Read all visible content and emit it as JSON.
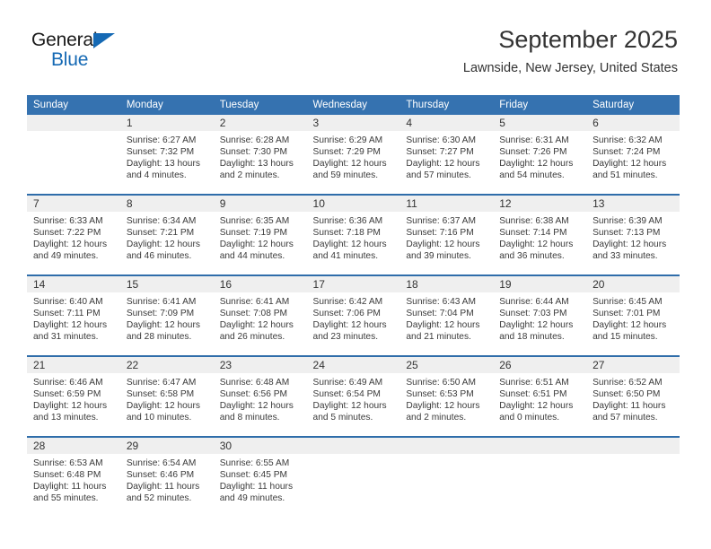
{
  "logo": {
    "word_top": "General",
    "word_bottom": "Blue",
    "triangle_icon": "blue-triangle-icon",
    "blue": "#1569b4"
  },
  "header": {
    "title": "September 2025",
    "subtitle": "Lawnside, New Jersey, United States"
  },
  "colors": {
    "header_row": "#3572b0",
    "row_divider": "#2f6daa",
    "day_band": "#efefef",
    "text": "#333333"
  },
  "weekday_headers": [
    "Sunday",
    "Monday",
    "Tuesday",
    "Wednesday",
    "Thursday",
    "Friday",
    "Saturday"
  ],
  "labels": {
    "sunrise_prefix": "Sunrise:",
    "sunset_prefix": "Sunset:",
    "daylight_prefix": "Daylight:"
  },
  "weeks": [
    [
      {
        "day": "",
        "empty": true
      },
      {
        "day": "1",
        "sunrise": "Sunrise: 6:27 AM",
        "sunset": "Sunset: 7:32 PM",
        "daylight_1": "Daylight: 13 hours",
        "daylight_2": "and 4 minutes."
      },
      {
        "day": "2",
        "sunrise": "Sunrise: 6:28 AM",
        "sunset": "Sunset: 7:30 PM",
        "daylight_1": "Daylight: 13 hours",
        "daylight_2": "and 2 minutes."
      },
      {
        "day": "3",
        "sunrise": "Sunrise: 6:29 AM",
        "sunset": "Sunset: 7:29 PM",
        "daylight_1": "Daylight: 12 hours",
        "daylight_2": "and 59 minutes."
      },
      {
        "day": "4",
        "sunrise": "Sunrise: 6:30 AM",
        "sunset": "Sunset: 7:27 PM",
        "daylight_1": "Daylight: 12 hours",
        "daylight_2": "and 57 minutes."
      },
      {
        "day": "5",
        "sunrise": "Sunrise: 6:31 AM",
        "sunset": "Sunset: 7:26 PM",
        "daylight_1": "Daylight: 12 hours",
        "daylight_2": "and 54 minutes."
      },
      {
        "day": "6",
        "sunrise": "Sunrise: 6:32 AM",
        "sunset": "Sunset: 7:24 PM",
        "daylight_1": "Daylight: 12 hours",
        "daylight_2": "and 51 minutes."
      }
    ],
    [
      {
        "day": "7",
        "sunrise": "Sunrise: 6:33 AM",
        "sunset": "Sunset: 7:22 PM",
        "daylight_1": "Daylight: 12 hours",
        "daylight_2": "and 49 minutes."
      },
      {
        "day": "8",
        "sunrise": "Sunrise: 6:34 AM",
        "sunset": "Sunset: 7:21 PM",
        "daylight_1": "Daylight: 12 hours",
        "daylight_2": "and 46 minutes."
      },
      {
        "day": "9",
        "sunrise": "Sunrise: 6:35 AM",
        "sunset": "Sunset: 7:19 PM",
        "daylight_1": "Daylight: 12 hours",
        "daylight_2": "and 44 minutes."
      },
      {
        "day": "10",
        "sunrise": "Sunrise: 6:36 AM",
        "sunset": "Sunset: 7:18 PM",
        "daylight_1": "Daylight: 12 hours",
        "daylight_2": "and 41 minutes."
      },
      {
        "day": "11",
        "sunrise": "Sunrise: 6:37 AM",
        "sunset": "Sunset: 7:16 PM",
        "daylight_1": "Daylight: 12 hours",
        "daylight_2": "and 39 minutes."
      },
      {
        "day": "12",
        "sunrise": "Sunrise: 6:38 AM",
        "sunset": "Sunset: 7:14 PM",
        "daylight_1": "Daylight: 12 hours",
        "daylight_2": "and 36 minutes."
      },
      {
        "day": "13",
        "sunrise": "Sunrise: 6:39 AM",
        "sunset": "Sunset: 7:13 PM",
        "daylight_1": "Daylight: 12 hours",
        "daylight_2": "and 33 minutes."
      }
    ],
    [
      {
        "day": "14",
        "sunrise": "Sunrise: 6:40 AM",
        "sunset": "Sunset: 7:11 PM",
        "daylight_1": "Daylight: 12 hours",
        "daylight_2": "and 31 minutes."
      },
      {
        "day": "15",
        "sunrise": "Sunrise: 6:41 AM",
        "sunset": "Sunset: 7:09 PM",
        "daylight_1": "Daylight: 12 hours",
        "daylight_2": "and 28 minutes."
      },
      {
        "day": "16",
        "sunrise": "Sunrise: 6:41 AM",
        "sunset": "Sunset: 7:08 PM",
        "daylight_1": "Daylight: 12 hours",
        "daylight_2": "and 26 minutes."
      },
      {
        "day": "17",
        "sunrise": "Sunrise: 6:42 AM",
        "sunset": "Sunset: 7:06 PM",
        "daylight_1": "Daylight: 12 hours",
        "daylight_2": "and 23 minutes."
      },
      {
        "day": "18",
        "sunrise": "Sunrise: 6:43 AM",
        "sunset": "Sunset: 7:04 PM",
        "daylight_1": "Daylight: 12 hours",
        "daylight_2": "and 21 minutes."
      },
      {
        "day": "19",
        "sunrise": "Sunrise: 6:44 AM",
        "sunset": "Sunset: 7:03 PM",
        "daylight_1": "Daylight: 12 hours",
        "daylight_2": "and 18 minutes."
      },
      {
        "day": "20",
        "sunrise": "Sunrise: 6:45 AM",
        "sunset": "Sunset: 7:01 PM",
        "daylight_1": "Daylight: 12 hours",
        "daylight_2": "and 15 minutes."
      }
    ],
    [
      {
        "day": "21",
        "sunrise": "Sunrise: 6:46 AM",
        "sunset": "Sunset: 6:59 PM",
        "daylight_1": "Daylight: 12 hours",
        "daylight_2": "and 13 minutes."
      },
      {
        "day": "22",
        "sunrise": "Sunrise: 6:47 AM",
        "sunset": "Sunset: 6:58 PM",
        "daylight_1": "Daylight: 12 hours",
        "daylight_2": "and 10 minutes."
      },
      {
        "day": "23",
        "sunrise": "Sunrise: 6:48 AM",
        "sunset": "Sunset: 6:56 PM",
        "daylight_1": "Daylight: 12 hours",
        "daylight_2": "and 8 minutes."
      },
      {
        "day": "24",
        "sunrise": "Sunrise: 6:49 AM",
        "sunset": "Sunset: 6:54 PM",
        "daylight_1": "Daylight: 12 hours",
        "daylight_2": "and 5 minutes."
      },
      {
        "day": "25",
        "sunrise": "Sunrise: 6:50 AM",
        "sunset": "Sunset: 6:53 PM",
        "daylight_1": "Daylight: 12 hours",
        "daylight_2": "and 2 minutes."
      },
      {
        "day": "26",
        "sunrise": "Sunrise: 6:51 AM",
        "sunset": "Sunset: 6:51 PM",
        "daylight_1": "Daylight: 12 hours",
        "daylight_2": "and 0 minutes."
      },
      {
        "day": "27",
        "sunrise": "Sunrise: 6:52 AM",
        "sunset": "Sunset: 6:50 PM",
        "daylight_1": "Daylight: 11 hours",
        "daylight_2": "and 57 minutes."
      }
    ],
    [
      {
        "day": "28",
        "sunrise": "Sunrise: 6:53 AM",
        "sunset": "Sunset: 6:48 PM",
        "daylight_1": "Daylight: 11 hours",
        "daylight_2": "and 55 minutes."
      },
      {
        "day": "29",
        "sunrise": "Sunrise: 6:54 AM",
        "sunset": "Sunset: 6:46 PM",
        "daylight_1": "Daylight: 11 hours",
        "daylight_2": "and 52 minutes."
      },
      {
        "day": "30",
        "sunrise": "Sunrise: 6:55 AM",
        "sunset": "Sunset: 6:45 PM",
        "daylight_1": "Daylight: 11 hours",
        "daylight_2": "and 49 minutes."
      },
      {
        "day": "",
        "empty": true
      },
      {
        "day": "",
        "empty": true
      },
      {
        "day": "",
        "empty": true
      },
      {
        "day": "",
        "empty": true
      }
    ]
  ]
}
